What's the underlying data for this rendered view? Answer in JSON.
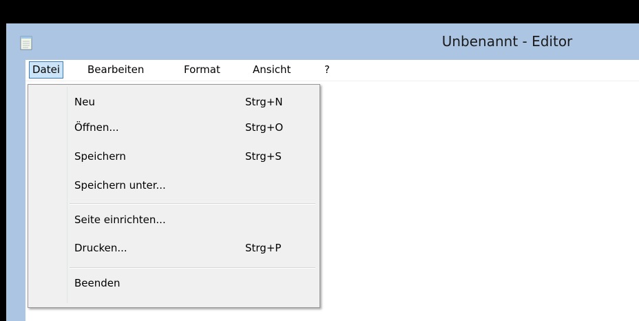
{
  "window": {
    "title": "Unbenannt - Editor",
    "icon": "notepad-icon"
  },
  "menubar": {
    "items": [
      {
        "label": "Datei",
        "active": true
      },
      {
        "label": "Bearbeiten"
      },
      {
        "label": "Format"
      },
      {
        "label": "Ansicht"
      },
      {
        "label": "?"
      }
    ]
  },
  "file_menu": {
    "items": [
      {
        "label": "Neu",
        "shortcut": "Strg+N"
      },
      {
        "label": "Öffnen...",
        "shortcut": "Strg+O"
      },
      {
        "label": "Speichern",
        "shortcut": "Strg+S"
      },
      {
        "label": "Speichern unter...",
        "shortcut": ""
      },
      {
        "label": "Seite einrichten...",
        "shortcut": ""
      },
      {
        "label": "Drucken...",
        "shortcut": "Strg+P"
      },
      {
        "label": "Beenden",
        "shortcut": ""
      }
    ]
  },
  "colors": {
    "titlebar": "#abc5e2",
    "menu_highlight": "#cce4f7",
    "menu_highlight_border": "#3b79c2",
    "dropdown_bg": "#f0f0f0"
  }
}
